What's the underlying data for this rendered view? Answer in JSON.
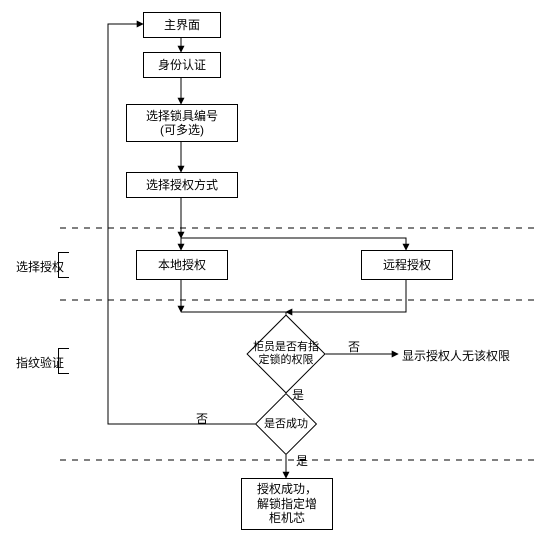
{
  "chart_data": {
    "type": "flowchart",
    "title": "",
    "nodes": [
      {
        "id": "main_ui",
        "label": "主界面",
        "shape": "rect"
      },
      {
        "id": "identity",
        "label": "身份认证",
        "shape": "rect"
      },
      {
        "id": "select_lock",
        "label": "选择锁具编号\n(可多选)",
        "shape": "rect"
      },
      {
        "id": "select_auth",
        "label": "选择授权方式",
        "shape": "rect"
      },
      {
        "id": "local_auth",
        "label": "本地授权",
        "shape": "rect"
      },
      {
        "id": "remote_auth",
        "label": "远程授权",
        "shape": "rect"
      },
      {
        "id": "has_perm",
        "label": "柜员是否有指\n定锁的权限",
        "shape": "diamond"
      },
      {
        "id": "success",
        "label": "是否成功",
        "shape": "diamond"
      },
      {
        "id": "result",
        "label": "授权成功，\n解锁指定增\n柜机芯",
        "shape": "rect"
      },
      {
        "id": "no_perm",
        "label": "显示授权人无该权限",
        "shape": "text"
      }
    ],
    "edges": [
      {
        "from": "main_ui",
        "to": "identity"
      },
      {
        "from": "identity",
        "to": "select_lock"
      },
      {
        "from": "select_lock",
        "to": "select_auth"
      },
      {
        "from": "select_auth",
        "to": "local_auth"
      },
      {
        "from": "select_auth",
        "to": "remote_auth"
      },
      {
        "from": "local_auth",
        "to": "has_perm"
      },
      {
        "from": "remote_auth",
        "to": "has_perm"
      },
      {
        "from": "has_perm",
        "to": "no_perm",
        "label": "否"
      },
      {
        "from": "has_perm",
        "to": "success",
        "label": "是"
      },
      {
        "from": "success",
        "to": "main_ui",
        "label": "否"
      },
      {
        "from": "success",
        "to": "result",
        "label": "是"
      }
    ],
    "lanes": [
      {
        "id": "lane_auth",
        "label": "选择授权"
      },
      {
        "id": "lane_fp",
        "label": "指纹验证"
      }
    ]
  },
  "nodes": {
    "main_ui": "主界面",
    "identity": "身份认证",
    "select_lock": "选择锁具编号\n(可多选)",
    "select_auth": "选择授权方式",
    "local_auth": "本地授权",
    "remote_auth": "远程授权",
    "has_perm": "柜员是否有指\n定锁的权限",
    "success": "是否成功",
    "result": "授权成功，\n解锁指定增\n柜机芯",
    "no_perm": "显示授权人无该权限"
  },
  "edges": {
    "yes": "是",
    "no": "否"
  },
  "lanes": {
    "auth": "选择授权",
    "fp": "指纹验证"
  }
}
